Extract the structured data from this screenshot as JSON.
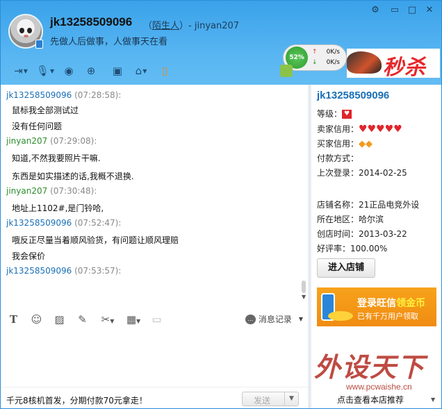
{
  "header": {
    "username": "jk13258509096",
    "stranger_label": "陌生人",
    "paren_open": "（",
    "paren_close": "）",
    "partner_suffix": "- jinyan207",
    "signature": "先做人后做事，人做事天在看"
  },
  "window_controls": {
    "settings": "⚙",
    "minimize": "▭",
    "maximize": "□",
    "close": "✕"
  },
  "speed": {
    "percent": "52%",
    "upload": "0K/s",
    "download": "0K/s"
  },
  "ad_banner": {
    "sale_text": "秒杀"
  },
  "messages": [
    {
      "sender": "jk13258509096",
      "time": "(07:28:58):",
      "role": "self",
      "lines": [
        "鼠标我全部测试过",
        "没有任何问题"
      ]
    },
    {
      "sender": "jinyan207",
      "time": "(07:29:08):",
      "role": "other",
      "lines": [
        "知道,不然我要照片干嘛.",
        "东西是如实描述的话,我概不退换."
      ]
    },
    {
      "sender": "jinyan207",
      "time": "(07:30:48):",
      "role": "other",
      "lines": [
        "地址上1102#,是门铃哈,"
      ]
    },
    {
      "sender": "jk13258509096",
      "time": "(07:52:47):",
      "role": "self",
      "lines": [
        "哦反正尽量当着顺风验货，有问题让顺风理赔",
        "我会保价"
      ]
    },
    {
      "sender": "jk13258509096",
      "time": "(07:53:57):",
      "role": "self",
      "lines": []
    }
  ],
  "input_toolbar": {
    "history_label": "消息记录"
  },
  "bottom": {
    "ad_text": "千元8核机首发，分期付款70元拿走！",
    "send_label": "发送"
  },
  "shop": {
    "title": "jk13258509096",
    "level_label": "等级：",
    "seller_credit_label": "卖家信用：",
    "buyer_credit_label": "买家信用：",
    "payment_label": "付款方式：",
    "last_login_label": "上次登录：",
    "last_login": "2014-02-25",
    "shop_name_label": "店铺名称：",
    "shop_name": "21正品电竞外设",
    "region_label": "所在地区：",
    "region": "哈尔滨",
    "created_label": "创店时间：",
    "created": "2013-03-22",
    "rating_label": "好评率：",
    "rating": "100.00%",
    "enter_button": "进入店铺",
    "recommend": "点击查看本店推荐"
  },
  "promo": {
    "line1_a": "登录旺信",
    "line1_b": "领金币",
    "line2": "已有千万用户领取"
  },
  "watermark": {
    "big": "外设天下",
    "url": "www.pcwaishe.cn"
  },
  "colors": {
    "header_blue": "#3aa2ea",
    "link_blue": "#1a6fb6",
    "partner_green": "#2c8d2c",
    "heart_red": "#e0252b",
    "promo_orange": "#f39a1c"
  }
}
